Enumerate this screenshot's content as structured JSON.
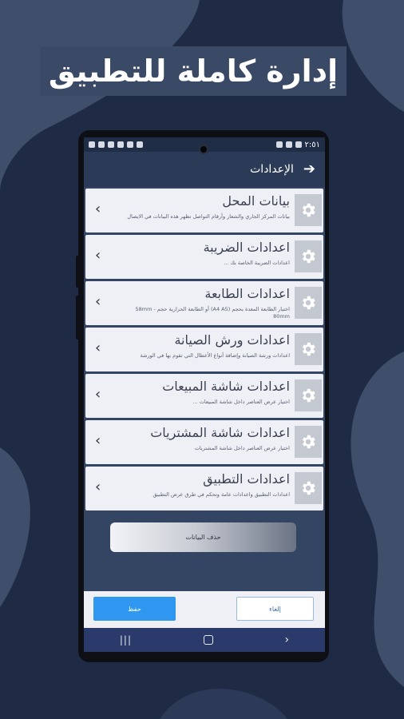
{
  "banner": {
    "text": "إدارة كاملة للتطبيق"
  },
  "statusbar": {
    "time": "٢:٥١"
  },
  "appbar": {
    "title": "الإعدادات",
    "back_icon": "arrow-right-icon"
  },
  "settings": [
    {
      "title": "بيانات المحل",
      "desc": "بيانات المركز الجاري والشعار وأرقام التواصل تظهر هذه البيانات في الايصال"
    },
    {
      "title": "اعدادات الضريبة",
      "desc": "اعدادات الضريبة الخاصة بك ..."
    },
    {
      "title": "اعدادات الطابعة",
      "desc": "اختيار الطابعة المعدة بحجم (A4 A5) أو الطابعة الحرارية حجم 58mm - 80mm"
    },
    {
      "title": "اعدادات ورش الصيانة",
      "desc": "اعدادات ورشة الصيانة وإضافة أنواع الأعطال التي تقوم بها في الورشة"
    },
    {
      "title": "اعدادات شاشة المبيعات",
      "desc": "اختيار عرض العناصر داخل شاشة المبيعات ..."
    },
    {
      "title": "اعدادات شاشة المشتريات",
      "desc": "اختيار عرض العناصر داخل شاشة المشتريات"
    },
    {
      "title": "اعدادات التطبيق",
      "desc": "اعدادات التطبيق واعدادات عامة وتحكم في طرق عرض التطبيق"
    }
  ],
  "delete_button": "حذف البيانات",
  "footer": {
    "save": "حفظ",
    "cancel": "إلغاء"
  },
  "colors": {
    "background": "#1f2b45",
    "accent": "#2f97f0",
    "screen": "#344563"
  }
}
